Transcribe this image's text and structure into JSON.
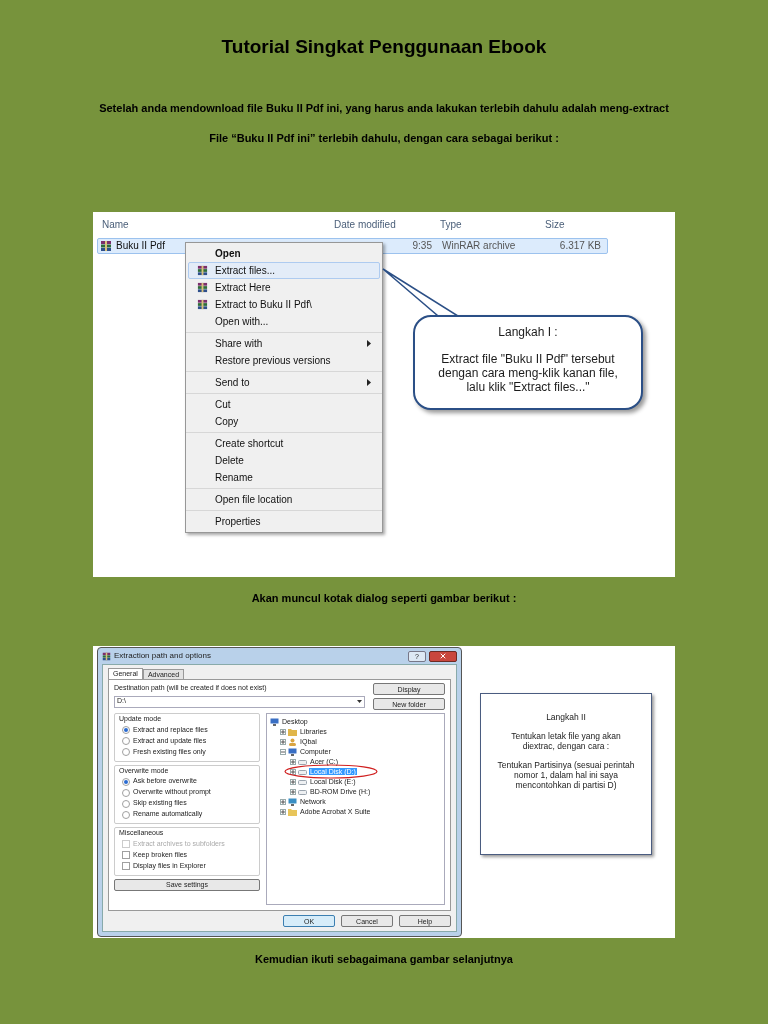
{
  "title": "Tutorial Singkat Penggunaan Ebook",
  "intro": [
    "Setelah anda mendownload file Buku II Pdf ini, yang harus anda lakukan terlebih dahulu adalah meng-extract",
    "File “Buku II Pdf ini” terlebih dahulu, dengan cara sebagai berikut :"
  ],
  "explorer": {
    "columns": [
      "Name",
      "Date modified",
      "Type",
      "Size"
    ],
    "file": {
      "name": "Buku II Pdf",
      "date": "9:35",
      "type": "WinRAR archive",
      "size": "6.317 KB",
      "selected": true
    },
    "context_menu": [
      [
        {
          "label": "Open",
          "kind": "default",
          "selected": false
        },
        {
          "label": "Extract files...",
          "kind": "archive",
          "selected": true
        },
        {
          "label": "Extract Here",
          "kind": "archive",
          "selected": false
        },
        {
          "label": "Extract to Buku II Pdf\\",
          "kind": "archive",
          "selected": false
        },
        {
          "label": "Open with...",
          "kind": "plain",
          "selected": false
        }
      ],
      [
        {
          "label": "Share with",
          "kind": "submenu",
          "selected": false
        },
        {
          "label": "Restore previous versions",
          "kind": "plain",
          "selected": false
        }
      ],
      [
        {
          "label": "Send to",
          "kind": "submenu",
          "selected": false
        }
      ],
      [
        {
          "label": "Cut",
          "kind": "plain",
          "selected": false
        },
        {
          "label": "Copy",
          "kind": "plain",
          "selected": false
        }
      ],
      [
        {
          "label": "Create shortcut",
          "kind": "plain",
          "selected": false
        },
        {
          "label": "Delete",
          "kind": "plain",
          "selected": false
        },
        {
          "label": "Rename",
          "kind": "plain",
          "selected": false
        }
      ],
      [
        {
          "label": "Open file location",
          "kind": "plain",
          "selected": false
        }
      ],
      [
        {
          "label": "Properties",
          "kind": "plain",
          "selected": false
        }
      ]
    ]
  },
  "callout_1": {
    "title": "Langkah I :",
    "text": "Extract file \"Buku II Pdf\" tersebut dengan cara meng-klik kanan file, lalu klik \"Extract files...\""
  },
  "caption_1": "Akan muncul kotak dialog seperti gambar berikut :",
  "dialog": {
    "title": "Extraction path and options",
    "help": "?",
    "tabs": [
      {
        "label": "General",
        "selected": true
      },
      {
        "label": "Advanced",
        "selected": false
      }
    ],
    "destination_label": "Destination path (will be created if does not exist)",
    "destination_value": "D:\\",
    "side_buttons": [
      "Display",
      "New folder"
    ],
    "groups": [
      {
        "title": "Update mode",
        "options": [
          {
            "label": "Extract and replace files",
            "kind": "radio",
            "checked": true,
            "disabled": false
          },
          {
            "label": "Extract and update files",
            "kind": "radio",
            "checked": false,
            "disabled": false
          },
          {
            "label": "Fresh existing files only",
            "kind": "radio",
            "checked": false,
            "disabled": false
          }
        ]
      },
      {
        "title": "Overwrite mode",
        "options": [
          {
            "label": "Ask before overwrite",
            "kind": "radio",
            "checked": true,
            "disabled": false
          },
          {
            "label": "Overwrite without prompt",
            "kind": "radio",
            "checked": false,
            "disabled": false
          },
          {
            "label": "Skip existing files",
            "kind": "radio",
            "checked": false,
            "disabled": false
          },
          {
            "label": "Rename automatically",
            "kind": "radio",
            "checked": false,
            "disabled": false
          }
        ]
      },
      {
        "title": "Miscellaneous",
        "options": [
          {
            "label": "Extract archives to subfolders",
            "kind": "checkbox",
            "checked": false,
            "disabled": true
          },
          {
            "label": "Keep broken files",
            "kind": "checkbox",
            "checked": false,
            "disabled": false
          },
          {
            "label": "Display files in Explorer",
            "kind": "checkbox",
            "checked": false,
            "disabled": false
          }
        ]
      }
    ],
    "save_button": "Save settings",
    "tree": [
      {
        "label": "Desktop",
        "kind": "desktop",
        "selected": false,
        "children": [
          {
            "label": "Libraries",
            "kind": "library",
            "expanded": false,
            "selected": false
          },
          {
            "label": "IQbal",
            "kind": "user",
            "expanded": false,
            "selected": false
          },
          {
            "label": "Computer",
            "kind": "computer",
            "expanded": true,
            "selected": false,
            "children": [
              {
                "label": "Acer (C:)",
                "kind": "drive",
                "expanded": false,
                "selected": false
              },
              {
                "label": "Local Disk (D:)",
                "kind": "drive",
                "expanded": false,
                "selected": true
              },
              {
                "label": "Local Disk (E:)",
                "kind": "drive",
                "expanded": false,
                "selected": false
              },
              {
                "label": "BD-ROM Drive (H:)",
                "kind": "drive",
                "expanded": false,
                "selected": false
              }
            ]
          },
          {
            "label": "Network",
            "kind": "network",
            "expanded": false,
            "selected": false
          },
          {
            "label": "Adobe Acrobat X Suite",
            "kind": "folder",
            "expanded": false,
            "selected": false
          }
        ]
      }
    ],
    "buttons": [
      {
        "label": "OK",
        "selected": true
      },
      {
        "label": "Cancel",
        "selected": false
      },
      {
        "label": "Help",
        "selected": false
      }
    ]
  },
  "callout_2": [
    "Langkah II",
    "Tentukan letak file yang akan diextrac, dengan cara :",
    "Tentukan Partisinya (sesuai perintah nomor 1, dalam hal ini saya mencontohkan di partisi D)"
  ],
  "caption_2": "Kemudian ikuti sebagaimana gambar selanjutnya"
}
